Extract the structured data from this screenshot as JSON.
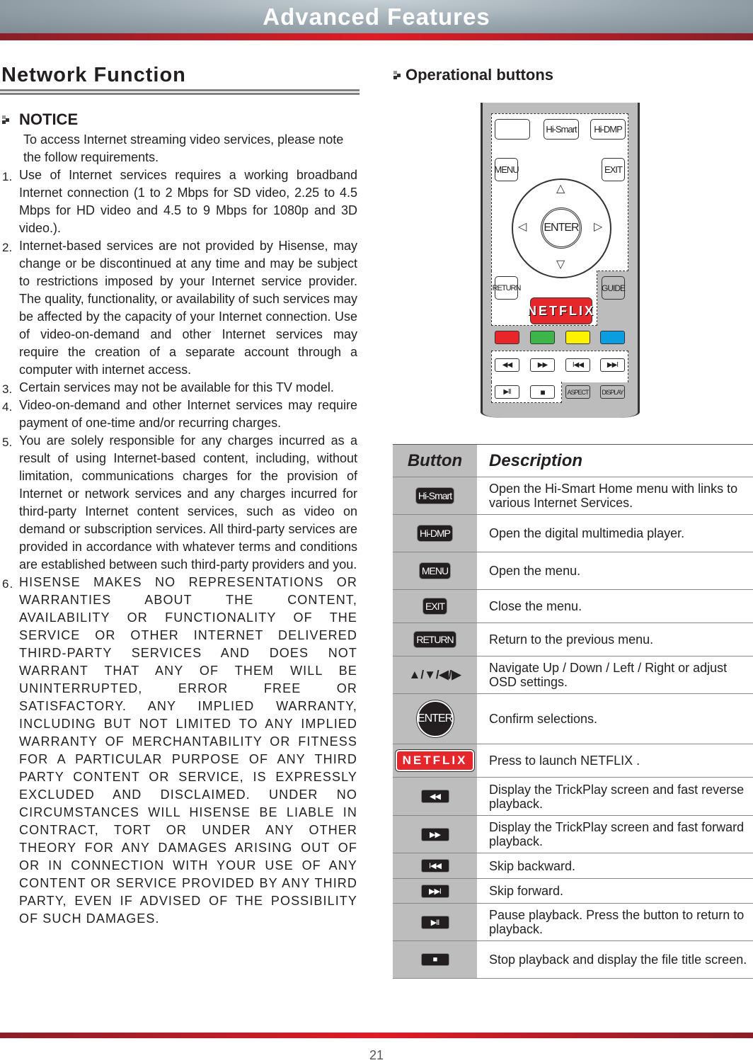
{
  "header": {
    "title": "Advanced Features"
  },
  "left": {
    "section_title": "Network Function",
    "notice_title": "NOTICE",
    "intro": "To access Internet streaming video services, please note the follow requirements.",
    "items": [
      {
        "num": "1.",
        "text": "Use of Internet services requires a working broadband Internet connection (1 to 2 Mbps for SD video, 2.25 to 4.5 Mbps for HD video and 4.5 to 9 Mbps for 1080p and 3D video.)."
      },
      {
        "num": "2.",
        "text": "Internet-based services are not provided by Hisense, may change or be discontinued at any time and may be subject to restrictions imposed by your Internet service provider. The quality, functionality, or availability of such services may be affected by the capacity of your Internet connection. Use of video-on-demand and other Internet services may require the creation of a separate account through a computer with internet access."
      },
      {
        "num": "3.",
        "text": "Certain services may not be available for this TV model."
      },
      {
        "num": "4.",
        "text": "Video-on-demand and other Internet services may require payment of one-time and/or recurring charges."
      },
      {
        "num": "5.",
        "text": "You are solely responsible for any charges incurred as a result of using Internet-based content, including, without limitation, communications charges for the provision of Internet or network services and any charges incurred for third-party Internet content services, such as video on demand or subscription services. All third-party services are provided in accordance with whatever terms and conditions are established between such third-party providers and you."
      },
      {
        "num": "6.",
        "text": "HISENSE MAKES NO REPRESENTATIONS OR WARRANTIES ABOUT THE CONTENT, AVAILABILITY OR FUNCTIONALITY OF THE SERVICE OR OTHER INTERNET DELIVERED THIRD-PARTY SERVICES AND DOES NOT WARRANT THAT ANY OF THEM WILL BE UNINTERRUPTED, ERROR FREE OR SATISFACTORY. ANY IMPLIED WARRANTY, INCLUDING BUT NOT LIMITED TO ANY IMPLIED WARRANTY OF MERCHANTABILITY OR FITNESS FOR A PARTICULAR PURPOSE OF ANY THIRD PARTY CONTENT OR SERVICE, IS EXPRESSLY EXCLUDED AND DISCLAIMED. UNDER NO CIRCUMSTANCES WILL HISENSE BE LIABLE IN CONTRACT, TORT OR UNDER ANY OTHER THEORY FOR ANY DAMAGES ARISING OUT OF OR IN CONNECTION WITH YOUR USE OF ANY CONTENT OR SERVICE PROVIDED BY ANY THIRD PARTY, EVEN IF ADVISED OF THE POSSIBILITY OF SUCH DAMAGES."
      }
    ]
  },
  "right": {
    "section_title": "Operational buttons",
    "remote": {
      "hismart": "Hi-Smart",
      "hidmp": "Hi-DMP",
      "menu": "MENU",
      "exit": "EXIT",
      "enter": "ENTER",
      "return": "RETURN",
      "guide": "GUIDE",
      "netflix": "NETFLIX",
      "aspect": "ASPECT",
      "display": "DISPLAY",
      "rew": "◀◀",
      "ff": "▶▶",
      "prev": "I◀◀",
      "next": "▶▶I",
      "play": "▶II",
      "stop": "■",
      "up": "△",
      "down": "▽",
      "left": "◁",
      "right": "▷",
      "colors": [
        "#e8262a",
        "#3db54a",
        "#fff200",
        "#0a9ee0"
      ]
    },
    "table": {
      "col_button": "Button",
      "col_description": "Description",
      "rows": [
        {
          "button": "Hi-Smart",
          "description": "Open the Hi-Smart Home menu with links to various Internet Services."
        },
        {
          "button": "Hi-DMP",
          "description": "Open the digital multimedia player."
        },
        {
          "button": "MENU",
          "description": "Open the menu."
        },
        {
          "button": "EXIT",
          "description": "Close the menu."
        },
        {
          "button": "RETURN",
          "description": "Return to the previous menu."
        },
        {
          "button": "▲/▼/◀/▶",
          "description": "Navigate Up / Down / Left / Right or adjust OSD settings."
        },
        {
          "button": "ENTER",
          "description": "Confirm selections."
        },
        {
          "button": "NETFLIX",
          "description": "Press to launch NETFLIX ."
        },
        {
          "button": "◀◀",
          "description": "Display the TrickPlay screen and fast reverse playback."
        },
        {
          "button": "▶▶",
          "description": "Display the TrickPlay screen and fast forward playback."
        },
        {
          "button": "I◀◀",
          "description": "Skip backward."
        },
        {
          "button": "▶▶I",
          "description": "Skip forward."
        },
        {
          "button": "▶II",
          "description": "Pause playback. Press the button to return to playback."
        },
        {
          "button": "■",
          "description": "Stop playback and display the file title screen."
        }
      ]
    }
  },
  "footer": {
    "page_number": "21"
  }
}
